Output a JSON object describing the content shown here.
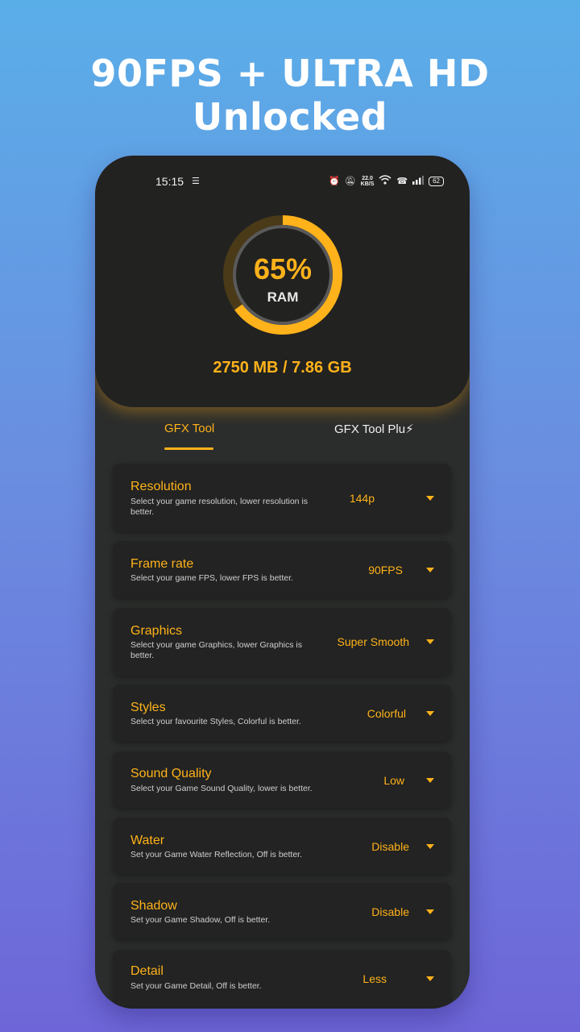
{
  "headline": "90FPS + ULTRA HD Unlocked",
  "status_bar": {
    "time": "15:15",
    "network_speed_value": "22.0",
    "network_speed_unit": "KB/S",
    "battery": "62"
  },
  "ram": {
    "percent_label": "65%",
    "percent_value": 65,
    "label": "RAM",
    "usage_text": "2750 MB / 7.86 GB"
  },
  "tabs": {
    "gfx_tool": "GFX Tool",
    "gfx_tool_plus": "GFX Tool Plu⚡"
  },
  "settings": [
    {
      "title": "Resolution",
      "desc": "Select your game resolution, lower resolution is better.",
      "value": "144p"
    },
    {
      "title": "Frame rate",
      "desc": "Select your game FPS, lower FPS is better.",
      "value": "90FPS"
    },
    {
      "title": "Graphics",
      "desc": "Select your game Graphics, lower Graphics is better.",
      "value": "Super Smooth"
    },
    {
      "title": "Styles",
      "desc": "Select your favourite Styles, Colorful  is better.",
      "value": "Colorful"
    },
    {
      "title": "Sound Quality",
      "desc": "Select your Game Sound Quality, lower  is better.",
      "value": "Low"
    },
    {
      "title": "Water",
      "desc": "Set your Game Water Reflection, Off  is better.",
      "value": "Disable"
    },
    {
      "title": "Shadow",
      "desc": "Set your Game Shadow, Off  is better.",
      "value": "Disable"
    },
    {
      "title": "Detail",
      "desc": "Set your Game Detail, Off  is better.",
      "value": "Less"
    }
  ],
  "colors": {
    "accent": "#ffb21a",
    "panel": "#222221",
    "background_top": "#5aaee8",
    "background_bottom": "#6e66d8"
  }
}
